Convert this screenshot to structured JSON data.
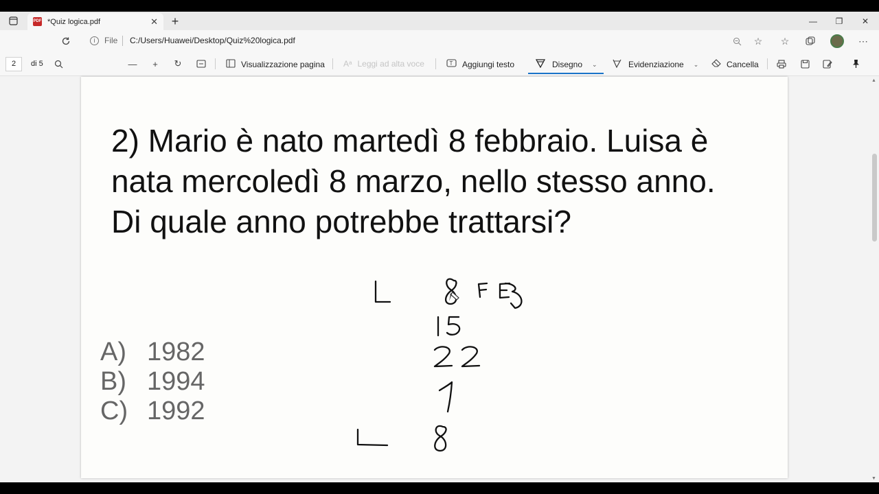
{
  "browser": {
    "tab_title": "*Quiz logica.pdf",
    "tab_icon_label": "PDF",
    "new_tab_label": "+",
    "minimize_label": "—",
    "restore_label": "❐",
    "close_label": "✕",
    "tab_close_label": "✕",
    "site_info_label": "File",
    "url": "C:/Users/Huawei/Desktop/Quiz%20logica.pdf"
  },
  "pdf_toolbar": {
    "page_number": "2",
    "page_total": "di 5",
    "view_label": "Visualizzazione pagina",
    "read_aloud_label": "Leggi ad alta voce",
    "add_text_label": "Aggiungi testo",
    "draw_label": "Disegno",
    "highlight_label": "Evidenziazione",
    "erase_label": "Cancella"
  },
  "document": {
    "question_lines": [
      "2)  Mario è nato martedì 8 febbraio. Luisa è",
      "nata mercoledì 8 marzo, nello stesso anno.",
      "Di quale anno potrebbe trattarsi?"
    ],
    "answers": [
      {
        "letter": "A)",
        "value": "1982"
      },
      {
        "letter": "B)",
        "value": "1994"
      },
      {
        "letter": "C)",
        "value": "1992"
      }
    ],
    "handwriting": [
      "L",
      "8",
      "FEB",
      "15",
      "22",
      "1",
      "L",
      "8"
    ]
  },
  "colors": {
    "ink": "#111111",
    "answers": "#666666",
    "accent": "#1a73c8"
  }
}
